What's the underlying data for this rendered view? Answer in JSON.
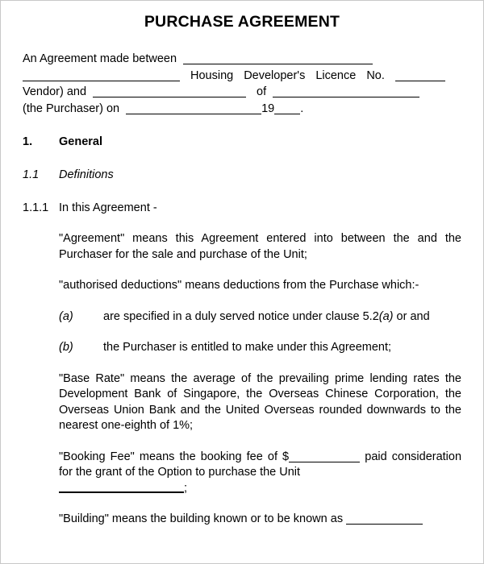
{
  "document": {
    "title": "PURCHASE AGREEMENT",
    "preamble": {
      "line1_a": "An Agreement made between",
      "line2_a": "Housing",
      "line2_b": "Developer's",
      "line2_c": "Licence",
      "line2_d": "No.",
      "line3_a": "Vendor) and",
      "line3_b": "of",
      "line4_a": "(the Purchaser) on",
      "line4_b": "19",
      "line4_c": "."
    },
    "clauses": [
      {
        "number": "1.",
        "heading": "General",
        "level": 1
      },
      {
        "number": "1.1",
        "heading": "Definitions",
        "level": 2
      },
      {
        "number": "1.1.1",
        "heading": "In this Agreement -",
        "level": 3
      }
    ],
    "definitions": [
      {
        "term": "Agreement",
        "text": "\"Agreement\" means this Agreement entered into between the and the Purchaser for the sale and purchase of the Unit;"
      },
      {
        "term": "authorised deductions",
        "text": "\"authorised deductions\" means deductions from the Purchase which:-"
      },
      {
        "term": "Base Rate",
        "text": "\"Base Rate\" means the average of the prevailing prime lending rates the Development Bank of Singapore, the Overseas Chinese Corporation, the Overseas Union Bank and the United Overseas rounded downwards to the nearest one-eighth of 1%;"
      }
    ],
    "subitems": [
      {
        "label": "(a)",
        "text_before": "are specified in a duly served notice under clause 5.2",
        "text_italic": "(a)",
        "text_after": "or and"
      },
      {
        "label": "(b)",
        "text_before": "the Purchaser is entitled to make under this Agreement;",
        "text_italic": "",
        "text_after": ""
      }
    ],
    "booking_fee": {
      "part1": "\"Booking Fee\" means the booking fee of $",
      "part2": "paid",
      "part3": "consideration for the grant of the Option to purchase the Unit",
      "part4": ";"
    },
    "building": {
      "text": "\"Building\" means the building known or to be known as"
    }
  }
}
